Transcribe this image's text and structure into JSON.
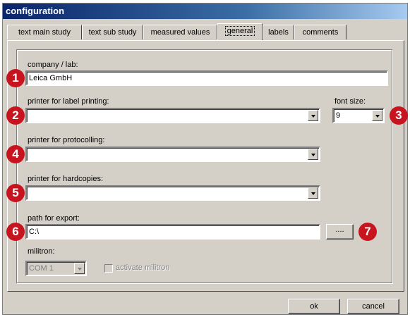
{
  "window": {
    "title": "configuration"
  },
  "tabs": [
    {
      "label": "text main study"
    },
    {
      "label": "text sub study"
    },
    {
      "label": "measured values"
    },
    {
      "label": "general",
      "active": true
    },
    {
      "label": "labels"
    },
    {
      "label": "comments"
    }
  ],
  "fields": {
    "company": {
      "label": "company / lab:",
      "value": "Leica GmbH"
    },
    "label_printer": {
      "label": "printer for label printing:",
      "value": ""
    },
    "font_size": {
      "label": "font size:",
      "value": "9"
    },
    "protocol_printer": {
      "label": "printer for protocolling:",
      "value": ""
    },
    "hardcopy_printer": {
      "label": "printer for hardcopies:",
      "value": ""
    },
    "export_path": {
      "label": "path for export:",
      "value": "C:\\",
      "browse_label": "...."
    },
    "militron": {
      "label": "militron:",
      "port": "COM 1",
      "activate_label": "activate militron"
    }
  },
  "badges": [
    "1",
    "2",
    "3",
    "4",
    "5",
    "6",
    "7"
  ],
  "buttons": {
    "ok": "ok",
    "cancel": "cancel"
  },
  "colors": {
    "badge": "#c8141e",
    "titlebar": "#0a246a",
    "face": "#d4d0c8"
  }
}
